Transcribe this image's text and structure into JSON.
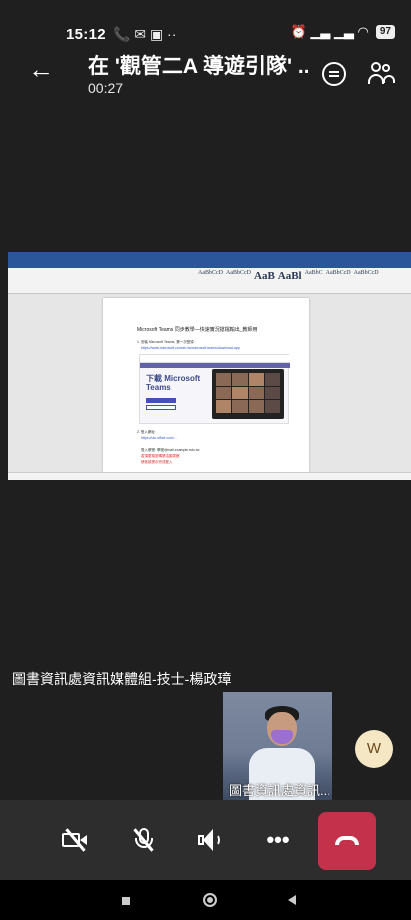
{
  "status_bar": {
    "time": "15:12",
    "left_icons": "📞 ✉ ▣ ··",
    "right_icons": "⏰ ▁▃ ▁▃ ◠",
    "battery": "97"
  },
  "header": {
    "title": "在 '觀管二A 導遊引隊' ...",
    "duration": "00:27"
  },
  "shared_screen": {
    "doc_title": "Microsoft Teams 同步教學—快速實況搶檔輸出_教師用",
    "step1": "1. 安裝 Microsoft Teams, 第一次登錄:",
    "step1_link": "https://www.microsoft.com/zh-tw/microsoft-teams/download-app",
    "teams_heading_line1": "下載 Microsoft",
    "teams_heading_line2": "Teams",
    "step2": "2. 登入網址:",
    "step2_link": "https://ulu.office.com/...",
    "login_name": "登入帳號: 學號@mail.example.edu.tw",
    "login_red1": "若須更換密碼請洽圖書館",
    "login_red2": "請依據提示完成登入",
    "style_labels": [
      "AaBbCcD",
      "AaBbCcD",
      "AaB",
      "AaBl",
      "AaBbC",
      "AaBbCcD",
      "AaBbCcD"
    ]
  },
  "presenter_name": "圖書資訊處資訊媒體組-技士-楊政璋",
  "self_video_label": "圖書資訊處資訊...",
  "participant_avatar": "W",
  "controls": {
    "more_label": "•••"
  },
  "colors": {
    "background": "#1f1f1f",
    "hangup": "#c4314b",
    "word_blue": "#2b579a",
    "avatar_bg": "#f5e6c4"
  }
}
